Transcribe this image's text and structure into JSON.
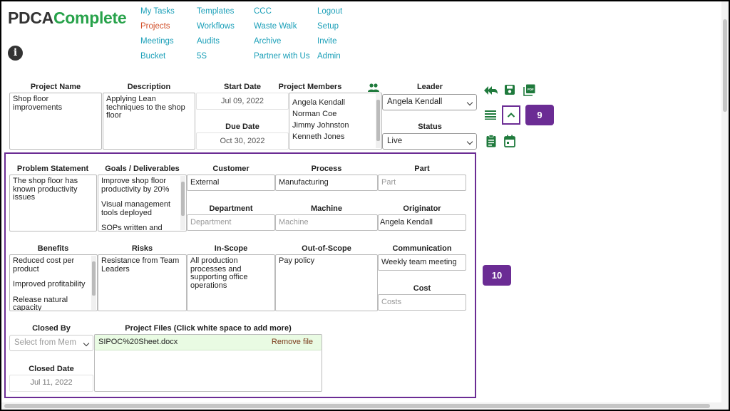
{
  "brand": {
    "part1": "PDCA",
    "part2": "Complete"
  },
  "nav": {
    "col1": [
      "My Tasks",
      "Projects",
      "Meetings",
      "Bucket"
    ],
    "col2": [
      "Templates",
      "Workflows",
      "Audits",
      "5S"
    ],
    "col3": [
      "CCC",
      "Waste Walk",
      "Archive",
      "Partner with Us"
    ],
    "col4": [
      "Logout",
      "Setup",
      "Invite",
      "Admin"
    ],
    "active": "Projects"
  },
  "header_fields": {
    "project_name": {
      "label": "Project Name",
      "value": "Shop floor improvements"
    },
    "description": {
      "label": "Description",
      "value": "Applying Lean techniques to the shop floor"
    },
    "start_date": {
      "label": "Start Date",
      "value": "Jul 09, 2022"
    },
    "due_date": {
      "label": "Due Date",
      "value": "Oct 30, 2022"
    },
    "members": {
      "label": "Project Members",
      "items": [
        "Angela Kendall",
        "Norman Coe",
        "Jimmy Johnston",
        "Kenneth Jones"
      ]
    },
    "leader": {
      "label": "Leader",
      "value": "Angela Kendall"
    },
    "status": {
      "label": "Status",
      "value": "Live"
    }
  },
  "details": {
    "problem_statement": {
      "label": "Problem Statement",
      "value": "The shop floor has known productivity issues"
    },
    "goals": {
      "label": "Goals / Deliverables",
      "items": [
        "Improve shop floor productivity by 20%",
        "Visual management tools deployed",
        "SOPs written and"
      ]
    },
    "customer": {
      "label": "Customer",
      "value": "External"
    },
    "process": {
      "label": "Process",
      "value": "Manufacturing"
    },
    "part": {
      "label": "Part",
      "placeholder": "Part"
    },
    "department": {
      "label": "Department",
      "placeholder": "Department"
    },
    "machine": {
      "label": "Machine",
      "placeholder": "Machine"
    },
    "originator": {
      "label": "Originator",
      "value": "Angela Kendall"
    },
    "benefits": {
      "label": "Benefits",
      "items": [
        "Reduced cost per product",
        "Improved profitability",
        "Release natural capacity"
      ]
    },
    "risks": {
      "label": "Risks",
      "value": "Resistance from Team Leaders"
    },
    "in_scope": {
      "label": "In-Scope",
      "value": "All production processes and supporting office operations"
    },
    "out_of_scope": {
      "label": "Out-of-Scope",
      "value": "Pay policy"
    },
    "communication": {
      "label": "Communication",
      "value": "Weekly team meeting"
    },
    "cost": {
      "label": "Cost",
      "placeholder": "Costs"
    },
    "closed_by": {
      "label": "Closed By",
      "placeholder": "Select from Mem"
    },
    "closed_date": {
      "label": "Closed Date",
      "value": "Jul 11, 2022"
    },
    "project_files": {
      "label": "Project Files (Click white space to add more)",
      "file": "SIPOC%20Sheet.docx",
      "remove": "Remove file"
    }
  },
  "badges": {
    "collapse": "9",
    "details": "10"
  },
  "icons": [
    "reply-all-icon",
    "save-icon",
    "pdf-icon",
    "list-icon",
    "chevron-up-icon",
    "clipboard-icon",
    "calendar-icon",
    "group-icon"
  ],
  "colors": {
    "brand_green": "#27a24a",
    "nav_link": "#1a9fb8",
    "nav_active": "#d2502a",
    "highlight": "#6b2c94",
    "icon_green": "#1f7a3c"
  }
}
